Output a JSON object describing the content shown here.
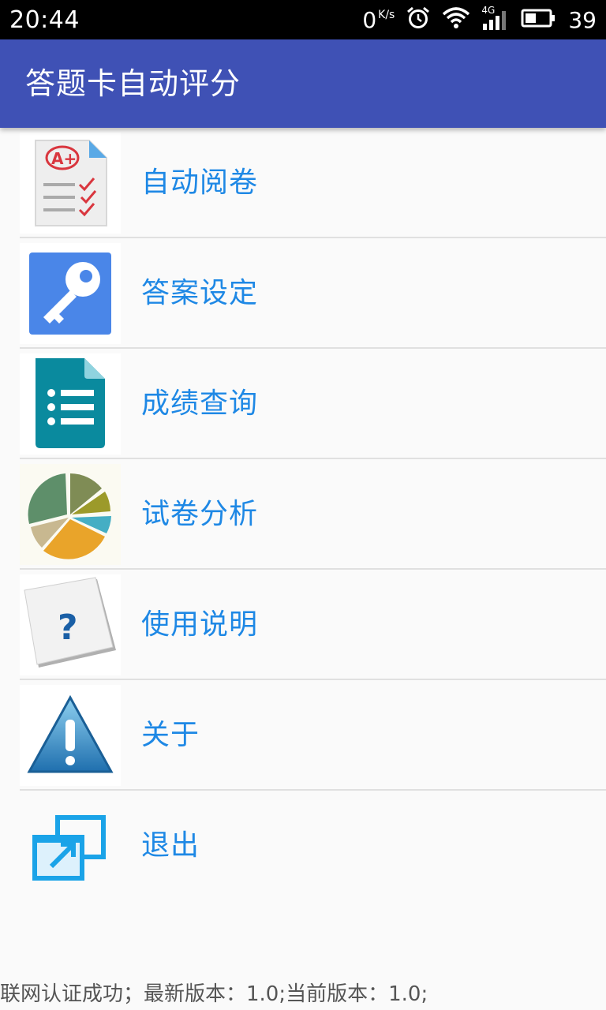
{
  "status_bar": {
    "time": "20:44",
    "net_speed": "0",
    "net_speed_unit": "K/s",
    "network_type": "4G",
    "battery_level": "39",
    "icons": [
      "alarm-icon",
      "wifi-icon",
      "signal-icon",
      "battery-icon"
    ]
  },
  "app_bar": {
    "title": "答题卡自动评分"
  },
  "menu": {
    "items": [
      {
        "label": "自动阅卷",
        "icon": "grading-sheet-icon"
      },
      {
        "label": "答案设定",
        "icon": "key-icon"
      },
      {
        "label": "成绩查询",
        "icon": "document-list-icon"
      },
      {
        "label": "试卷分析",
        "icon": "pie-chart-icon"
      },
      {
        "label": "使用说明",
        "icon": "question-mark-icon"
      },
      {
        "label": "关于",
        "icon": "warning-icon"
      },
      {
        "label": "退出",
        "icon": "exit-window-icon"
      }
    ]
  },
  "footer": {
    "status_text": "联网认证成功；最新版本：1.0;当前版本：1.0;"
  },
  "colors": {
    "app_bar": "#3f51b5",
    "menu_label": "#1e88e5",
    "divider": "#e0e0e0",
    "background": "#fafafa"
  }
}
